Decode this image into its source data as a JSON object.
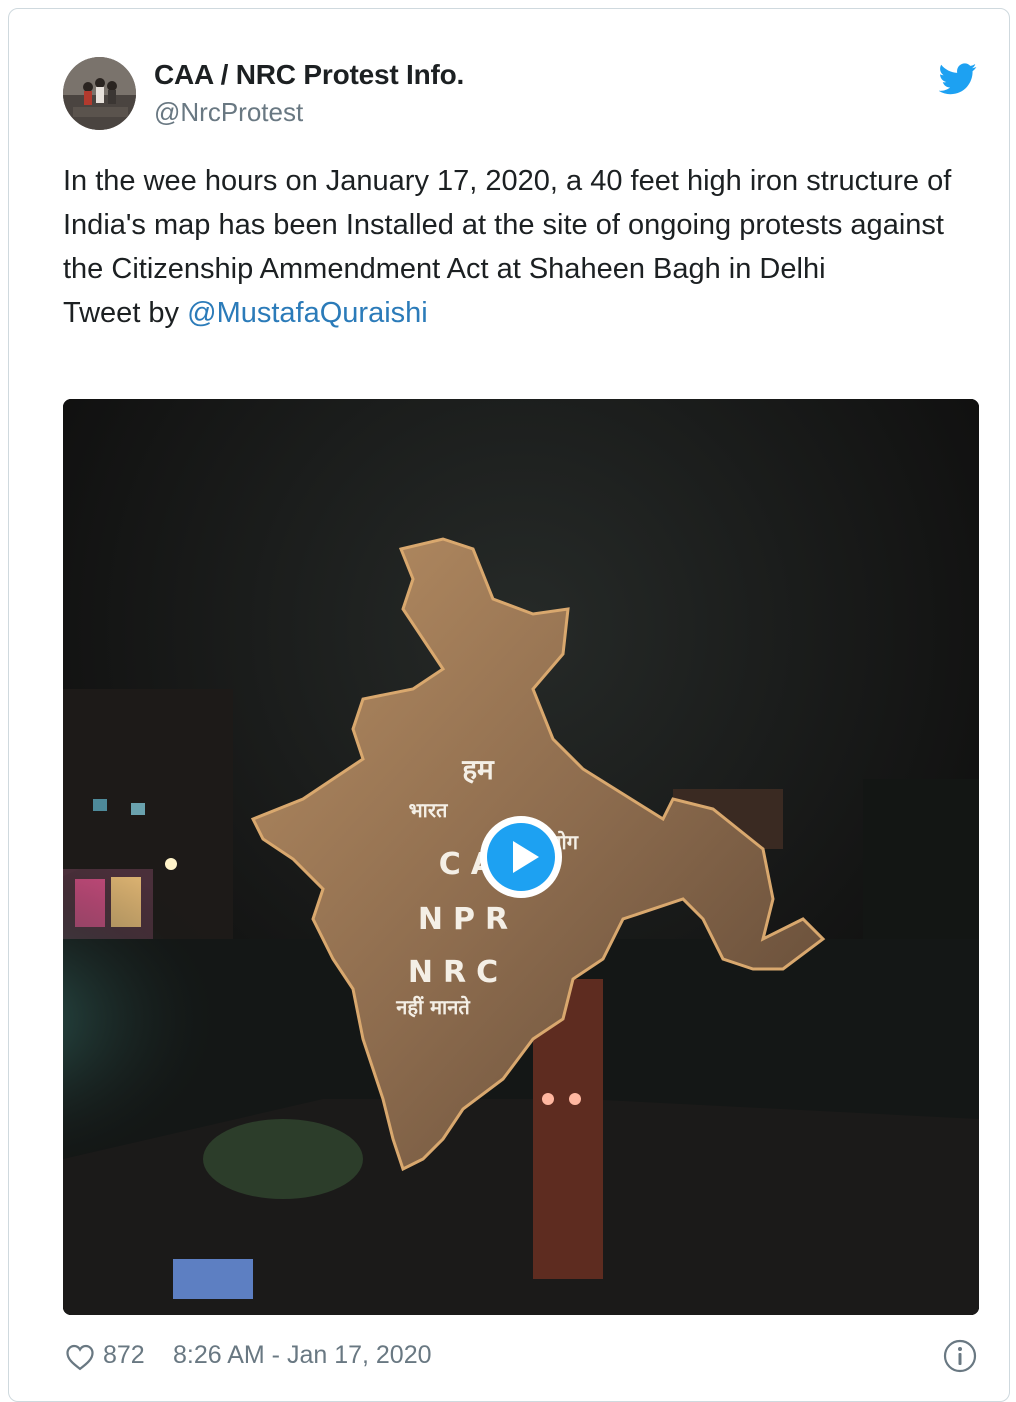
{
  "author": {
    "name": "CAA / NRC Protest Info.",
    "handle": "@NrcProtest"
  },
  "tweet": {
    "text": "In the wee hours on January 17, 2020, a 40 feet high iron structure of India's map has been Installed at the site of ongoing protests against the Citizenship Ammendment Act at Shaheen Bagh in Delhi",
    "attribution_prefix": "Tweet by",
    "mention": "@MustafaQuraishi"
  },
  "media": {
    "type": "video",
    "overlay_text": {
      "line1": "हम",
      "line2_left": "भारत",
      "line2_right": "लोग",
      "line3": "CAA",
      "line4": "NPR",
      "line5": "NRC",
      "line6": "नहीं  मानते"
    }
  },
  "footer": {
    "like_count": "872",
    "timestamp": "8:26 AM - Jan 17, 2020"
  },
  "icons": {
    "brand": "twitter-bird-icon",
    "like": "heart-icon",
    "play": "play-icon",
    "info": "info-icon"
  },
  "colors": {
    "link": "#2b7bb9",
    "brand_blue": "#1da1f2",
    "secondary_text": "#697882",
    "primary_text": "#1c2022"
  }
}
